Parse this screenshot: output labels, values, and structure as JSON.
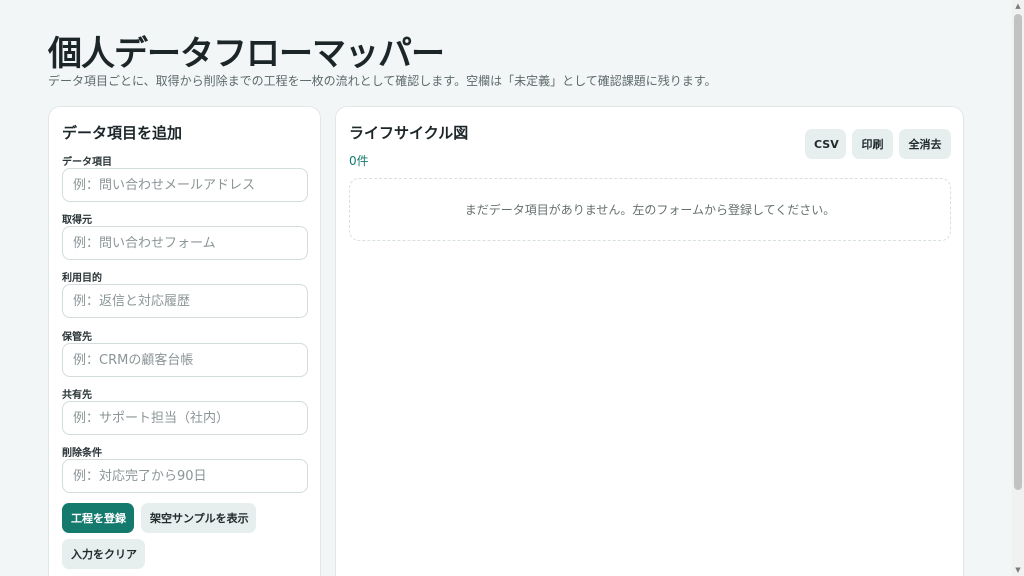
{
  "header": {
    "title": "個人データフローマッパー",
    "subtitle": "データ項目ごとに、取得から削除までの工程を一枚の流れとして確認します。空欄は「未定義」として確認課題に残ります。"
  },
  "form": {
    "title": "データ項目を追加",
    "fields": [
      {
        "label": "データ項目",
        "placeholder": "例：問い合わせメールアドレス",
        "value": ""
      },
      {
        "label": "取得元",
        "placeholder": "例：問い合わせフォーム",
        "value": ""
      },
      {
        "label": "利用目的",
        "placeholder": "例：返信と対応履歴",
        "value": ""
      },
      {
        "label": "保管先",
        "placeholder": "例：CRMの顧客台帳",
        "value": ""
      },
      {
        "label": "共有先",
        "placeholder": "例：サポート担当（社内）",
        "value": ""
      },
      {
        "label": "削除条件",
        "placeholder": "例：対応完了から90日",
        "value": ""
      }
    ],
    "buttons": {
      "register": "工程を登録",
      "sample": "架空サンプルを表示",
      "clear": "入力をクリア"
    }
  },
  "lifecycle": {
    "title": "ライフサイクル図",
    "count": "0件",
    "buttons": {
      "csv": "CSV",
      "print": "印刷",
      "clear_all": "全消去"
    },
    "empty_message": "まだデータ項目がありません。左のフォームから登録してください。"
  },
  "colors": {
    "accent": "#157a6e",
    "background": "#f3f6f6",
    "soft_button": "#e6eeee"
  }
}
